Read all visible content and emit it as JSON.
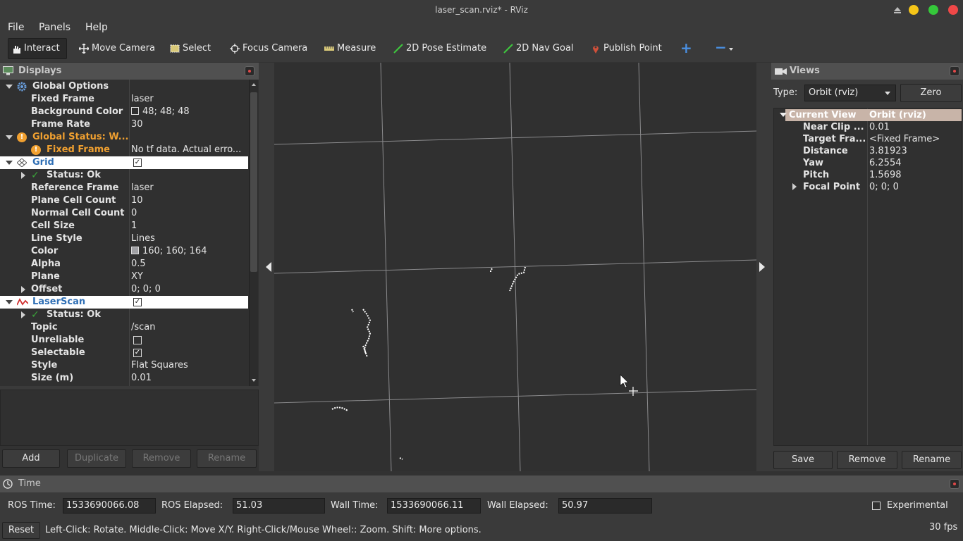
{
  "window": {
    "title": "laser_scan.rviz* - RViz"
  },
  "menu": [
    "File",
    "Panels",
    "Help"
  ],
  "toolbar": {
    "interact": "Interact",
    "move_camera": "Move Camera",
    "select": "Select",
    "focus_camera": "Focus Camera",
    "measure": "Measure",
    "pose_estimate": "2D Pose Estimate",
    "nav_goal": "2D Nav Goal",
    "publish_point": "Publish Point",
    "plus": "+",
    "minus": "−"
  },
  "displays": {
    "title": "Displays",
    "rows": [
      {
        "k": "Global Options",
        "v": ""
      },
      {
        "k": "Fixed Frame",
        "v": "laser"
      },
      {
        "k": "Background Color",
        "v": "48; 48; 48"
      },
      {
        "k": "Frame Rate",
        "v": "30"
      },
      {
        "k": "Global Status: W...",
        "v": ""
      },
      {
        "k": "Fixed Frame",
        "v": "No tf data.  Actual erro..."
      },
      {
        "k": "Grid",
        "v": ""
      },
      {
        "k": "Status: Ok",
        "v": ""
      },
      {
        "k": "Reference Frame",
        "v": "laser"
      },
      {
        "k": "Plane Cell Count",
        "v": "10"
      },
      {
        "k": "Normal Cell Count",
        "v": "0"
      },
      {
        "k": "Cell Size",
        "v": "1"
      },
      {
        "k": "Line Style",
        "v": "Lines"
      },
      {
        "k": "Color",
        "v": "160; 160; 164"
      },
      {
        "k": "Alpha",
        "v": "0.5"
      },
      {
        "k": "Plane",
        "v": "XY"
      },
      {
        "k": "Offset",
        "v": "0; 0; 0"
      },
      {
        "k": "LaserScan",
        "v": ""
      },
      {
        "k": "Status: Ok",
        "v": ""
      },
      {
        "k": "Topic",
        "v": "/scan"
      },
      {
        "k": "Unreliable",
        "v": ""
      },
      {
        "k": "Selectable",
        "v": ""
      },
      {
        "k": "Style",
        "v": "Flat Squares"
      },
      {
        "k": "Size (m)",
        "v": "0.01"
      }
    ],
    "buttons": {
      "add": "Add",
      "duplicate": "Duplicate",
      "remove": "Remove",
      "rename": "Rename"
    }
  },
  "views": {
    "title": "Views",
    "type_label": "Type:",
    "type_value": "Orbit (rviz)",
    "zero": "Zero",
    "rows": [
      {
        "k": "Current View",
        "v": "Orbit (rviz)"
      },
      {
        "k": "Near Clip ...",
        "v": "0.01"
      },
      {
        "k": "Target Fra...",
        "v": "<Fixed Frame>"
      },
      {
        "k": "Distance",
        "v": "3.81923"
      },
      {
        "k": "Yaw",
        "v": "6.2554"
      },
      {
        "k": "Pitch",
        "v": "1.5698"
      },
      {
        "k": "Focal Point",
        "v": "0; 0; 0"
      }
    ],
    "buttons": {
      "save": "Save",
      "remove": "Remove",
      "rename": "Rename"
    }
  },
  "time": {
    "title": "Time",
    "ros_time_label": "ROS Time:",
    "ros_time": "1533690066.08",
    "ros_elapsed_label": "ROS Elapsed:",
    "ros_elapsed": "51.03",
    "wall_time_label": "Wall Time:",
    "wall_time": "1533690066.11",
    "wall_elapsed_label": "Wall Elapsed:",
    "wall_elapsed": "50.97",
    "experimental": "Experimental"
  },
  "status": {
    "reset": "Reset",
    "hint": "Left-Click: Rotate.  Middle-Click: Move X/Y.  Right-Click/Mouse Wheel:: Zoom.  Shift: More options.",
    "fps": "30 fps"
  },
  "colors": {
    "accent": "#2f6fb5",
    "warning": "#f0a030",
    "ok": "#3aa43a",
    "background": "#303030"
  }
}
